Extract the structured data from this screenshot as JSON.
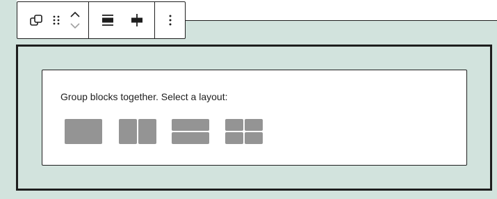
{
  "toolbar": {
    "buttons": [
      {
        "icon": "group-icon"
      },
      {
        "icon": "drag-handle-icon"
      },
      {
        "icon": "move-up-down-icon"
      },
      {
        "icon": "justify-stretch-icon"
      },
      {
        "icon": "justify-center-icon"
      },
      {
        "icon": "more-options-icon"
      }
    ]
  },
  "placeholder": {
    "instructions": "Group blocks together. Select a layout:",
    "variations": [
      {
        "icon": "group-layout-icon"
      },
      {
        "icon": "row-layout-icon"
      },
      {
        "icon": "stack-layout-icon"
      },
      {
        "icon": "grid-layout-icon"
      }
    ]
  },
  "colors": {
    "canvas_bg": "#d2e3dd",
    "border": "#1e1e1e",
    "variation_fill": "#949494"
  }
}
